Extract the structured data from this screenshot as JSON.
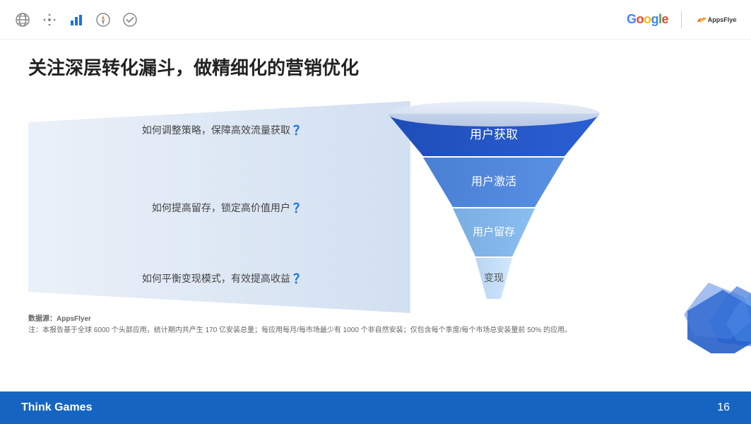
{
  "nav": {
    "icons": [
      "globe",
      "move",
      "bar-chart",
      "compass",
      "check-circle"
    ],
    "active_index": 2
  },
  "logos": {
    "google_text": "Google",
    "appsflyer_text": "Appsflyer"
  },
  "title": "关注深层转化漏斗，做精细化的营销优化",
  "questions": [
    {
      "text": "如何调整策略，保障高效流量获取",
      "mark": "？"
    },
    {
      "text": "如何提高留存，锁定高价值用户",
      "mark": "？"
    },
    {
      "text": "如何平衡变现模式，有效提高收益",
      "mark": "？"
    }
  ],
  "funnel_stages": [
    {
      "label": "用户获取",
      "color1": "#1e4db7",
      "color2": "#2557c7"
    },
    {
      "label": "用户激活",
      "color1": "#4a80d4",
      "color2": "#5a90e4"
    },
    {
      "label": "用户留存",
      "color1": "#7aaee0",
      "color2": "#8abef0"
    },
    {
      "label": "变现",
      "color1": "#b8d4ef",
      "color2": "#c8e4ff"
    }
  ],
  "note": {
    "source_label": "数据源：AppsFlyer",
    "note_text": "注：本报告基于全球 6000 个头部应用，统计期内共产生 170 亿安装总量；每应用每月/每市场最少有 1000 个非自然安装；仅包含每个季度/每个市场总安装量前 50% 的应用。"
  },
  "footer": {
    "brand": "Think Games",
    "page_number": "16"
  }
}
